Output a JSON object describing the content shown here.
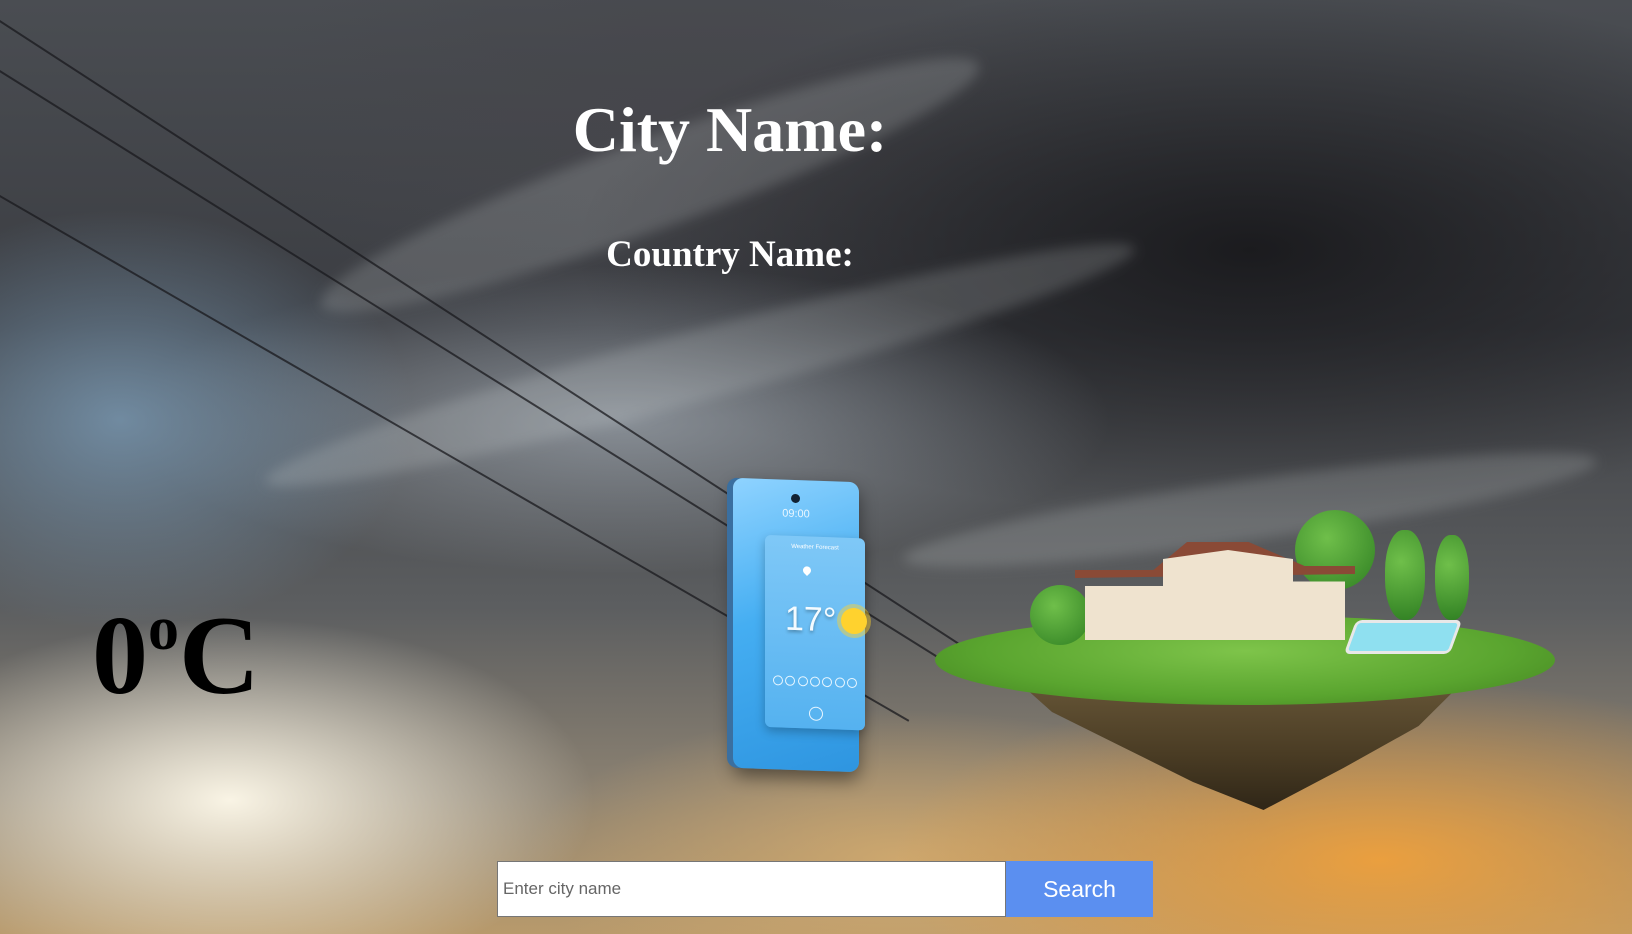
{
  "header": {
    "city_label": "City Name:",
    "country_label": "Country Name:"
  },
  "weather": {
    "temperature_value": "0",
    "degree_symbol": "o",
    "unit": "C"
  },
  "illustration": {
    "phone_time": "09:00",
    "phone_title": "Weather Forecast",
    "phone_temp": "17°"
  },
  "search": {
    "placeholder": "Enter city name",
    "value": "",
    "button_label": "Search"
  },
  "colors": {
    "search_button": "#5b8ff0",
    "heading_text": "#ffffff",
    "temperature_text": "#000000"
  }
}
